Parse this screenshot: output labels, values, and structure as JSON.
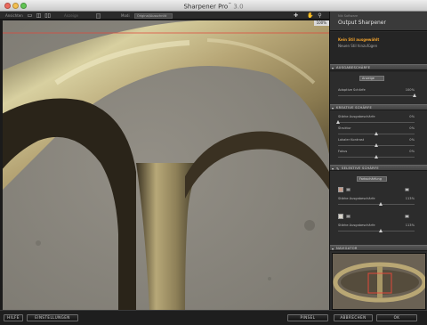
{
  "window": {
    "title": "Sharpener Pro",
    "title_sup": "™",
    "version": " 3.0"
  },
  "toolbar": {
    "view_label": "Ansichten",
    "scale_label": "Anzeige",
    "view_mode_label": "Modi",
    "view_mode_value": "Original/Ausschnitt"
  },
  "canvas": {
    "zoom_badge": "100%"
  },
  "panel": {
    "brand_small": "Nik Software",
    "brand_main": "Output Sharpener",
    "preset_selected": "Kein Stil ausgewählt",
    "preset_new": "Neuen Stil hinzufügen",
    "sections": {
      "output": "AUSGABESCHÄRFE",
      "creative": "KREATIVE SCHÄRFE",
      "selective": "SELEKTIVE SCHÄRFE",
      "navigator": "NAVIGATOR"
    },
    "output": {
      "method_value": "Anzeige",
      "adaptive_label": "Adaptive Schärfe",
      "adaptive_value": "100%",
      "adaptive_level": 1.0
    },
    "creative": {
      "rows": [
        {
          "label": "Stärke Ausgabeschärfe",
          "value": "0%",
          "level": 0.0
        },
        {
          "label": "Struktur",
          "value": "0%",
          "level": 0.5
        },
        {
          "label": "Lokaler Kontrast",
          "value": "0%",
          "level": 0.5
        },
        {
          "label": "Fokus",
          "value": "0%",
          "level": 0.5
        }
      ]
    },
    "selective": {
      "mode_value": "Farbschärfung",
      "rows": [
        {
          "label": "Stärke Ausgabeschärfe",
          "value": "113%",
          "level": 0.56,
          "swatch": "#c49a88"
        },
        {
          "label": "Stärke Ausgabeschärfe",
          "value": "113%",
          "level": 0.56,
          "swatch": "#d8d4ca"
        }
      ]
    }
  },
  "footer": {
    "help": "HILFE",
    "settings": "EINSTELLUNGEN",
    "brush": "PINSEL",
    "cancel": "ABBRECHEN",
    "ok": "OK"
  },
  "colors": {
    "preset_accent": "#f0a22c",
    "guide_line": "#e0473a",
    "panel_bg": "#2c2c2c"
  }
}
